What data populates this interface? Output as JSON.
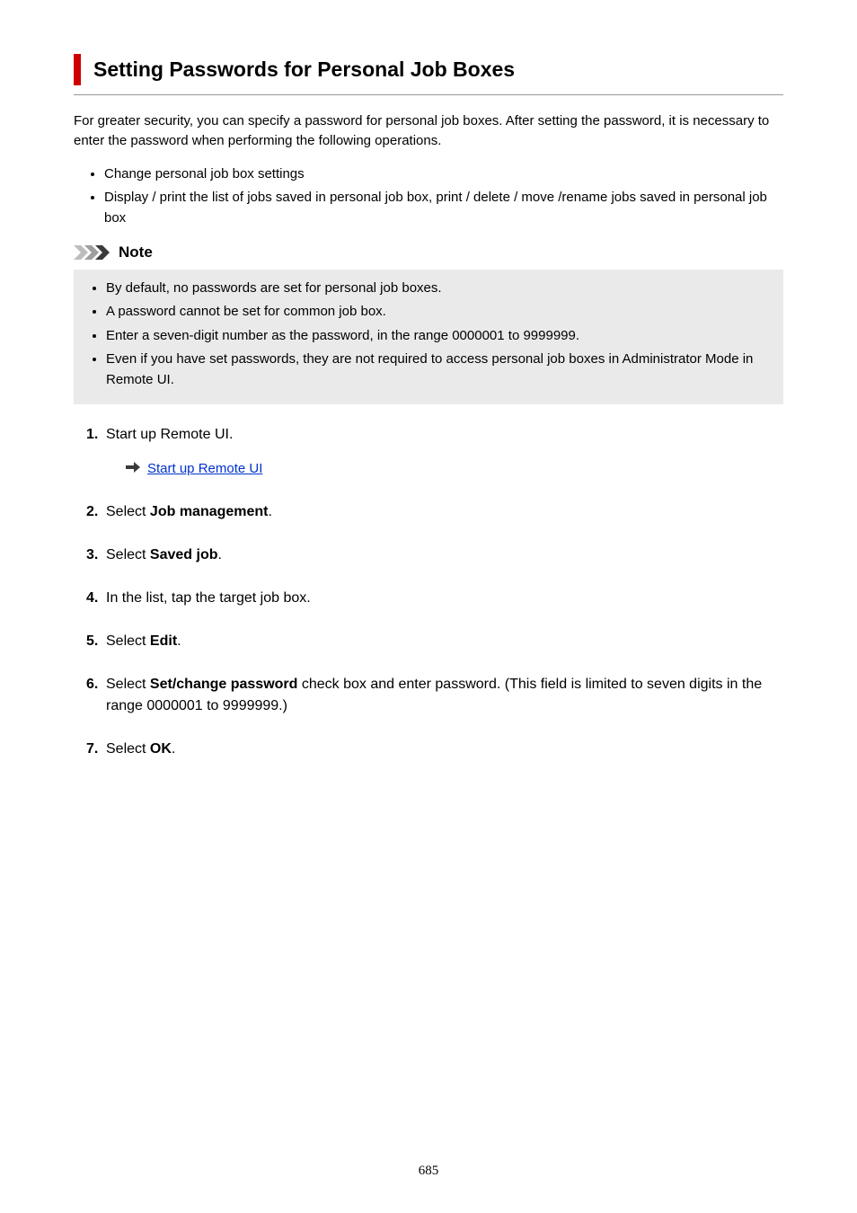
{
  "title": "Setting Passwords for Personal Job Boxes",
  "intro": "For greater security, you can specify a password for personal job boxes. After setting the password, it is necessary to enter the password when performing the following operations.",
  "bullets": [
    "Change personal job box settings",
    "Display / print the list of jobs saved in personal job box, print / delete / move /rename jobs saved in personal job box"
  ],
  "note": {
    "label": "Note",
    "items": [
      "By default, no passwords are set for personal job boxes.",
      "A password cannot be set for common job box.",
      "Enter a seven-digit number as the password, in the range 0000001 to 9999999.",
      "Even if you have set passwords, they are not required to access personal job boxes in Administrator Mode in Remote UI."
    ]
  },
  "steps": [
    {
      "num": "1.",
      "prefix": "Start up Remote UI.",
      "link": "Start up Remote UI"
    },
    {
      "num": "2.",
      "prefix": "Select ",
      "bold": "Job management",
      "suffix": "."
    },
    {
      "num": "3.",
      "prefix": "Select ",
      "bold": "Saved job",
      "suffix": "."
    },
    {
      "num": "4.",
      "prefix": "In the list, tap the target job box."
    },
    {
      "num": "5.",
      "prefix": "Select ",
      "bold": "Edit",
      "suffix": "."
    },
    {
      "num": "6.",
      "prefix": "Select ",
      "bold": "Set/change password",
      "suffix": " check box and enter password. (This field is limited to seven digits in the range 0000001 to 9999999.)"
    },
    {
      "num": "7.",
      "prefix": "Select ",
      "bold": "OK",
      "suffix": "."
    }
  ],
  "page_number": "685"
}
